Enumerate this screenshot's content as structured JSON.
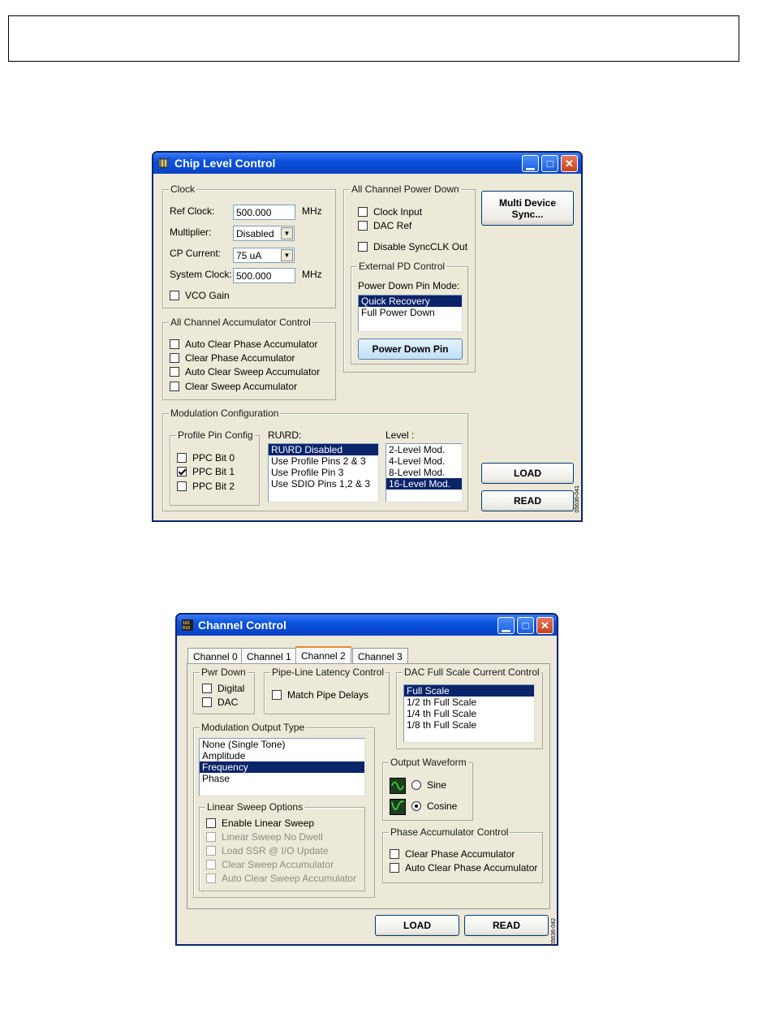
{
  "chip": {
    "title": "Chip Level Control",
    "clock": {
      "group": "Clock",
      "ref_label": "Ref Clock:",
      "ref_value": "500.000",
      "ref_unit": "MHz",
      "mult_label": "Multiplier:",
      "mult_value": "Disabled",
      "cp_label": "CP Current:",
      "cp_value": "75 uA",
      "sys_label": "System Clock:",
      "sys_value": "500.000",
      "sys_unit": "MHz",
      "vco": "VCO Gain"
    },
    "acc": {
      "group": "All Channel Accumulator Control",
      "items": [
        "Auto Clear Phase Accumulator",
        "Clear Phase Accumulator",
        "Auto Clear Sweep Accumulator",
        "Clear Sweep Accumulator"
      ]
    },
    "pd": {
      "group": "All Channel Power Down",
      "clock_input": "Clock Input",
      "dac_ref": "DAC Ref",
      "disable_sync": "Disable SyncCLK Out",
      "ext_group": "External PD Control",
      "pin_mode_label": "Power Down Pin Mode:",
      "pin_modes": [
        "Quick Recovery",
        "Full Power Down"
      ],
      "pin_button": "Power Down Pin"
    },
    "mod": {
      "group": "Modulation Configuration",
      "ppc_group": "Profile Pin Config",
      "ppc": [
        "PPC Bit 0",
        "PPC Bit 1",
        "PPC Bit 2"
      ],
      "rurd_label": "RU\\RD:",
      "rurd": [
        "RU\\RD Disabled",
        "Use Profile Pins 2 & 3",
        "Use Profile Pin 3",
        "Use SDIO Pins 1,2 & 3"
      ],
      "level_label": "Level :",
      "levels": [
        "2-Level Mod.",
        "4-Level Mod.",
        "8-Level Mod.",
        "16-Level Mod."
      ]
    },
    "multi_sync": "Multi Device\nSync...",
    "load": "LOAD",
    "read": "READ",
    "fig_id": "05636-041"
  },
  "channel": {
    "title": "Channel Control",
    "tabs": [
      "Channel 0",
      "Channel 1",
      "Channel 2",
      "Channel 3"
    ],
    "pwr": {
      "group": "Pwr Down",
      "digital": "Digital",
      "dac": "DAC"
    },
    "pipe": {
      "group": "Pipe-Line Latency Control",
      "match": "Match Pipe Delays"
    },
    "dacfs": {
      "group": "DAC Full Scale Current Control",
      "items": [
        "Full Scale",
        "1/2 th Full Scale",
        "1/4 th Full Scale",
        "1/8 th Full Scale"
      ]
    },
    "modout": {
      "group": "Modulation Output Type",
      "items": [
        "None (Single Tone)",
        "Amplitude",
        "Frequency",
        "Phase"
      ]
    },
    "sweep": {
      "group": "Linear Sweep Options",
      "items": [
        "Enable Linear Sweep",
        "Linear Sweep No Dwell",
        "Load SSR @ I/O Update",
        "Clear Sweep Accumulator",
        "Auto Clear Sweep Accumulator"
      ]
    },
    "wave": {
      "group": "Output Waveform",
      "sine": "Sine",
      "cosine": "Cosine"
    },
    "phase": {
      "group": "Phase Accumulator Control",
      "items": [
        "Clear Phase Accumulator",
        "Auto Clear Phase Accumulator"
      ]
    },
    "load": "LOAD",
    "read": "READ",
    "fig_id": "05636-042"
  },
  "colors": {
    "title_blue": "#0a52dc",
    "selection": "#0a246a",
    "face": "#ece9d8"
  }
}
